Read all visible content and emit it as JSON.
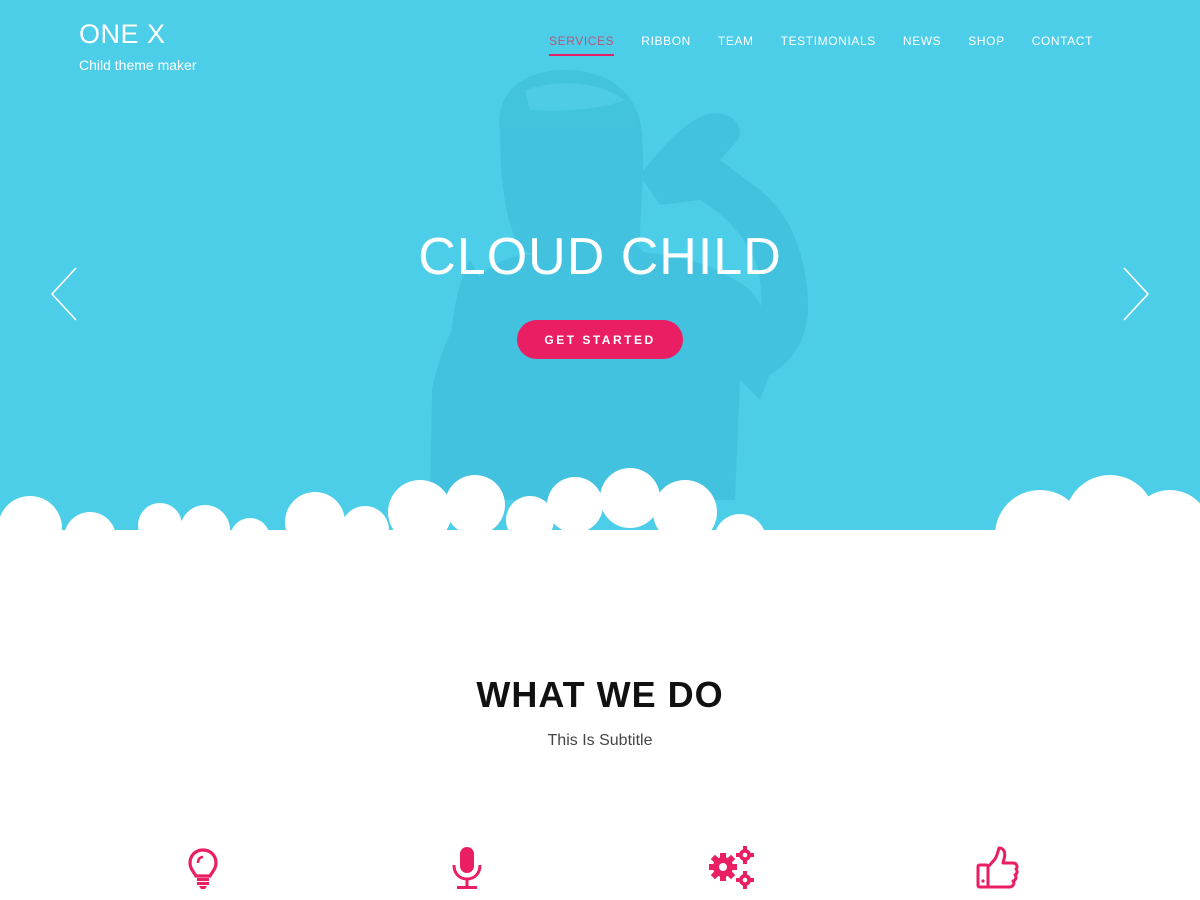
{
  "brand": {
    "title": "ONE X",
    "tagline": "Child theme maker"
  },
  "nav": {
    "items": [
      {
        "label": "SERVICES",
        "active": true
      },
      {
        "label": "RIBBON",
        "active": false
      },
      {
        "label": "TEAM",
        "active": false
      },
      {
        "label": "TESTIMONIALS",
        "active": false
      },
      {
        "label": "NEWS",
        "active": false
      },
      {
        "label": "SHOP",
        "active": false
      },
      {
        "label": "CONTACT",
        "active": false
      }
    ]
  },
  "hero": {
    "title": "CLOUD CHILD",
    "cta_label": "GET STARTED",
    "prev_icon": "chevron-left-icon",
    "next_icon": "chevron-right-icon"
  },
  "services": {
    "heading": "WHAT WE DO",
    "subtitle": "This Is Subtitle",
    "icons": [
      "lightbulb-icon",
      "microphone-icon",
      "gears-icon",
      "thumbs-up-icon"
    ]
  },
  "colors": {
    "hero_background": "#4ccde8",
    "accent": "#e91e63",
    "active_nav_text": "#b5587c",
    "heading": "#111111",
    "cloud": "#ffffff"
  }
}
